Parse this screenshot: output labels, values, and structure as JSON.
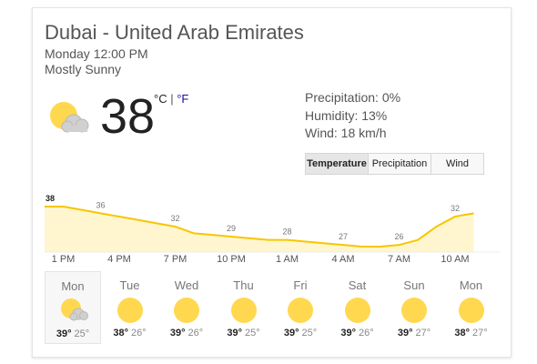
{
  "location": "Dubai - United Arab Emirates",
  "datetime": "Monday 12:00 PM",
  "condition": "Mostly Sunny",
  "current_temp": "38",
  "units": {
    "c": "°C",
    "sep": "|",
    "f": "°F"
  },
  "details": {
    "precipitation": "Precipitation: 0%",
    "humidity": "Humidity: 13%",
    "wind": "Wind: 18 km/h"
  },
  "tabs": [
    "Temperature",
    "Precipitation",
    "Wind"
  ],
  "active_tab": "Temperature",
  "colors": {
    "sun": "#ffd84f",
    "chart_line": "#f7c600",
    "chart_fill": "#fff6cf"
  },
  "chart_data": {
    "type": "area",
    "x": [
      "12 PM",
      "1 PM",
      "2 PM",
      "3 PM",
      "4 PM",
      "5 PM",
      "6 PM",
      "7 PM",
      "8 PM",
      "9 PM",
      "10 PM",
      "11 PM",
      "12 AM",
      "1 AM",
      "2 AM",
      "3 AM",
      "4 AM",
      "5 AM",
      "6 AM",
      "7 AM",
      "8 AM",
      "9 AM",
      "10 AM",
      "11 AM"
    ],
    "values": [
      38,
      38,
      37,
      36,
      35,
      34,
      33,
      32,
      30,
      29.5,
      29,
      28.5,
      28,
      28,
      27.5,
      27,
      26.5,
      26,
      26,
      26.5,
      28,
      32,
      35,
      36
    ],
    "data_labels": [
      {
        "index": 0,
        "text": "38"
      },
      {
        "index": 3,
        "text": "36"
      },
      {
        "index": 7,
        "text": "32"
      },
      {
        "index": 10,
        "text": "29"
      },
      {
        "index": 13,
        "text": "28"
      },
      {
        "index": 16,
        "text": "27"
      },
      {
        "index": 19,
        "text": "26"
      },
      {
        "index": 22,
        "text": "32"
      }
    ],
    "tick_labels": [
      {
        "index": 1,
        "text": "1 PM"
      },
      {
        "index": 4,
        "text": "4 PM"
      },
      {
        "index": 7,
        "text": "7 PM"
      },
      {
        "index": 10,
        "text": "10 PM"
      },
      {
        "index": 13,
        "text": "1 AM"
      },
      {
        "index": 16,
        "text": "4 AM"
      },
      {
        "index": 19,
        "text": "7 AM"
      },
      {
        "index": 22,
        "text": "10 AM"
      }
    ]
  },
  "forecast": [
    {
      "day": "Mon",
      "high": "39°",
      "low": "25°",
      "icon": "partly-cloudy-icon",
      "selected": true
    },
    {
      "day": "Tue",
      "high": "38°",
      "low": "26°",
      "icon": "sun-icon"
    },
    {
      "day": "Wed",
      "high": "39°",
      "low": "26°",
      "icon": "sun-icon"
    },
    {
      "day": "Thu",
      "high": "39°",
      "low": "25°",
      "icon": "sun-icon"
    },
    {
      "day": "Fri",
      "high": "39°",
      "low": "25°",
      "icon": "sun-icon"
    },
    {
      "day": "Sat",
      "high": "39°",
      "low": "26°",
      "icon": "sun-icon"
    },
    {
      "day": "Sun",
      "high": "39°",
      "low": "27°",
      "icon": "sun-icon"
    },
    {
      "day": "Mon",
      "high": "38°",
      "low": "27°",
      "icon": "sun-icon"
    }
  ]
}
